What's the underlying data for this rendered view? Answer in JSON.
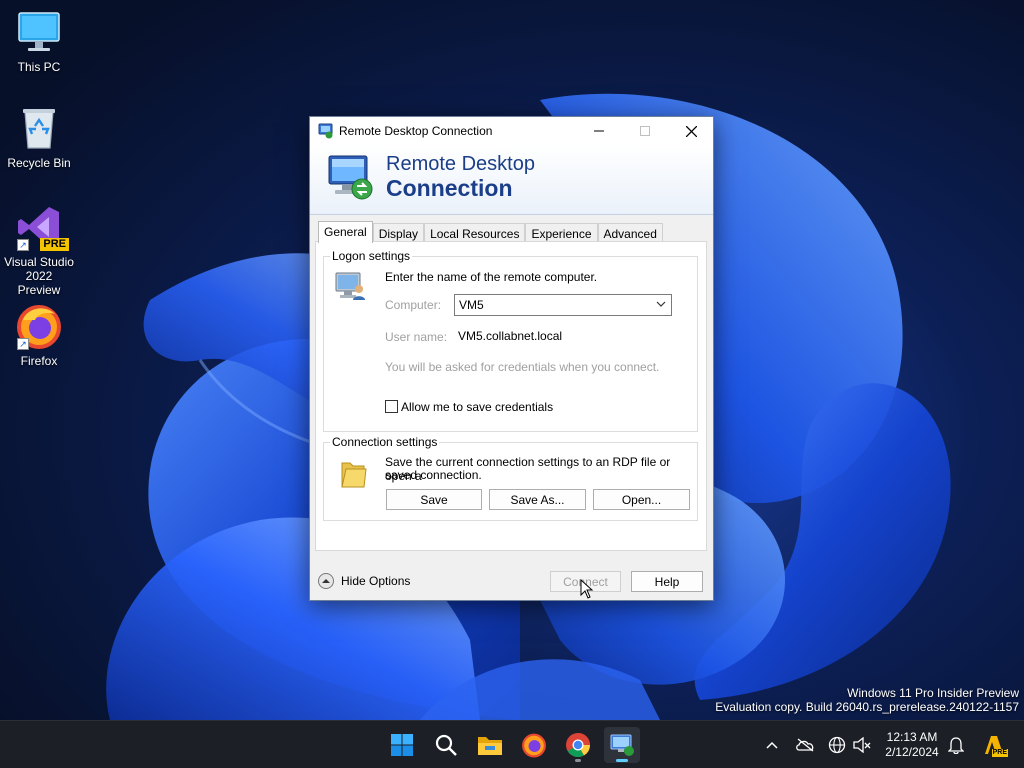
{
  "desktop": {
    "icons": [
      {
        "label": "This PC",
        "icon": "monitor-icon"
      },
      {
        "label": "Recycle Bin",
        "icon": "recycle-bin-icon"
      },
      {
        "label": "Visual Studio 2022 Preview",
        "icon": "visual-studio-icon",
        "badge": "PRE"
      },
      {
        "label": "Firefox",
        "icon": "firefox-icon"
      }
    ]
  },
  "watermark": {
    "line1": "Windows 11 Pro Insider Preview",
    "line2": "Evaluation copy. Build 26040.rs_prerelease.240122-1157"
  },
  "dialog": {
    "title": "Remote Desktop Connection",
    "banner_line1": "Remote Desktop",
    "banner_line2": "Connection",
    "tabs": [
      {
        "label": "General",
        "active": true
      },
      {
        "label": "Display"
      },
      {
        "label": "Local Resources"
      },
      {
        "label": "Experience"
      },
      {
        "label": "Advanced"
      }
    ],
    "logon": {
      "group_label": "Logon settings",
      "instruction": "Enter the name of the remote computer.",
      "computer_label": "Computer:",
      "computer_value": "VM5",
      "username_label": "User name:",
      "username_value": "VM5.collabnet.local",
      "credentials_note": "You will be asked for credentials when you connect.",
      "save_credentials_label": "Allow me to save credentials",
      "save_credentials_checked": false
    },
    "connection": {
      "group_label": "Connection settings",
      "description_line1": "Save the current connection settings to an RDP file or open a",
      "description_line2": "saved connection.",
      "save_label": "Save",
      "save_as_label": "Save As...",
      "open_label": "Open..."
    },
    "footer": {
      "hide_options_label": "Hide Options",
      "connect_label": "Connect",
      "help_label": "Help"
    }
  },
  "taskbar": {
    "clock_time": "12:13 AM",
    "clock_date": "2/12/2024",
    "apps": [
      "start-icon",
      "search-icon",
      "file-explorer-icon",
      "firefox-icon",
      "chrome-icon",
      "remote-desktop-icon"
    ],
    "copilot_badge": "PRE"
  },
  "colors": {
    "accent": "#60cdff",
    "banner_text": "#1a3f88",
    "taskbar_bg": "#1c1f26"
  }
}
